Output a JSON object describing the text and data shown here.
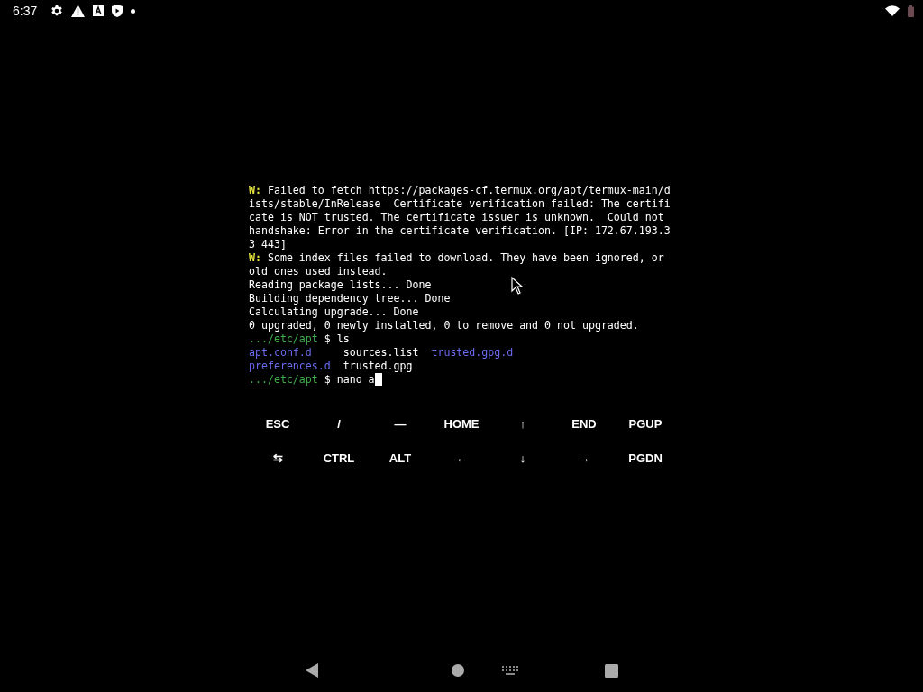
{
  "status_bar": {
    "time": "6:37"
  },
  "terminal": {
    "lines": [
      [
        {
          "kind": "warn",
          "text": "W:"
        },
        {
          "kind": "plain",
          "text": " Failed to fetch https://packages-cf.termux.org/apt/termux-main/d"
        }
      ],
      [
        {
          "kind": "plain",
          "text": "ists/stable/InRelease  Certificate verification failed: The certifi"
        }
      ],
      [
        {
          "kind": "plain",
          "text": "cate is NOT trusted. The certificate issuer is unknown.  Could not"
        }
      ],
      [
        {
          "kind": "plain",
          "text": "handshake: Error in the certificate verification. [IP: 172.67.193.3"
        }
      ],
      [
        {
          "kind": "plain",
          "text": "3 443]"
        }
      ],
      [
        {
          "kind": "warn",
          "text": "W:"
        },
        {
          "kind": "plain",
          "text": " Some index files failed to download. They have been ignored, or"
        }
      ],
      [
        {
          "kind": "plain",
          "text": "old ones used instead."
        }
      ],
      [
        {
          "kind": "plain",
          "text": "Reading package lists... Done"
        }
      ],
      [
        {
          "kind": "plain",
          "text": "Building dependency tree... Done"
        }
      ],
      [
        {
          "kind": "plain",
          "text": "Calculating upgrade... Done"
        }
      ],
      [
        {
          "kind": "plain",
          "text": "0 upgraded, 0 newly installed, 0 to remove and 0 not upgraded."
        }
      ],
      [
        {
          "kind": "prompt",
          "text": ".../etc/apt"
        },
        {
          "kind": "plain",
          "text": " $ ls"
        }
      ],
      [
        {
          "kind": "dir",
          "text": "apt.conf.d"
        },
        {
          "kind": "plain",
          "text": "     sources.list  "
        },
        {
          "kind": "dir",
          "text": "trusted.gpg.d"
        }
      ],
      [
        {
          "kind": "dir",
          "text": "preferences.d"
        },
        {
          "kind": "plain",
          "text": "  trusted.gpg"
        }
      ],
      [
        {
          "kind": "prompt",
          "text": ".../etc/apt"
        },
        {
          "kind": "plain",
          "text": " $ nano a"
        }
      ]
    ]
  },
  "extra_keys": [
    [
      "ESC",
      "/",
      "—",
      "HOME",
      "↑",
      "END",
      "PGUP"
    ],
    [
      "⇆",
      "CTRL",
      "ALT",
      "←",
      "↓",
      "→",
      "PGDN"
    ]
  ]
}
